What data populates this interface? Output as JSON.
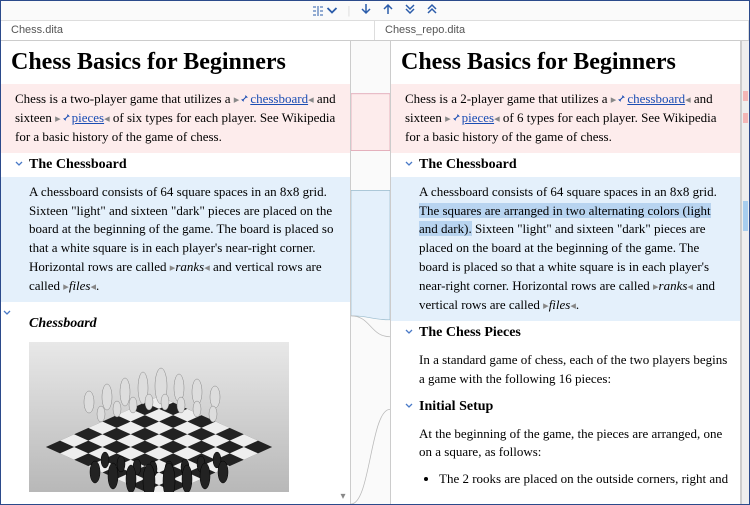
{
  "toolbar": {
    "algo_icon": "algorithm-icon",
    "dropdown_icon": "dropdown-icon",
    "next_diff_icon": "arrow-down-icon",
    "prev_diff_icon": "arrow-up-icon",
    "last_diff_icon": "double-arrow-down-icon",
    "first_diff_icon": "double-arrow-up-icon"
  },
  "tabs": {
    "left": "Chess.dita",
    "right": "Chess_repo.dita"
  },
  "left": {
    "title": "Chess Basics for Beginners",
    "intro_pre": "Chess is a ",
    "intro_two": "two-player",
    "intro_mid1": " game that utilizes a ",
    "link_board": "chessboard",
    "intro_mid2": " and sixteen ",
    "link_pieces": "pieces",
    "intro_mid3": " of ",
    "intro_six": "six",
    "intro_post": " types for each player. See Wikipedia for a basic history of the game of chess.",
    "sec1_title": "The Chessboard",
    "sec1_body": "A chessboard consists of 64 square spaces in an 8x8 grid. Sixteen \"light\" and sixteen \"dark\" pieces are placed on the board at the beginning of the game. The board is placed so that a white square is in each player's near-right corner. Horizontal rows are called ",
    "ranks": "ranks",
    "sec1_mid": " and vertical rows are called ",
    "files": "files",
    "period": ".",
    "fig_title": "Chessboard"
  },
  "right": {
    "title": "Chess Basics for Beginners",
    "intro_pre": "Chess is a ",
    "intro_two": "2-player",
    "intro_mid1": " game that utilizes a ",
    "link_board": "chessboard",
    "intro_mid2": " and sixteen ",
    "link_pieces": "pieces",
    "intro_mid3": " of ",
    "intro_six": "6",
    "intro_post": " types for each player. See Wikipedia for a basic history of the game of chess.",
    "sec1_title": "The Chessboard",
    "sec1_p1": "A chessboard consists of 64 square spaces in an 8x8 grid. ",
    "sec1_ins": "The squares are arranged in two alternating colors (light and dark).",
    "sec1_p2": " Sixteen \"light\" and sixteen \"dark\" pieces are placed on the board at the beginning of the game. The board is placed so that a white square is in each player's near-right corner. Horizontal rows are called ",
    "ranks": "ranks",
    "sec1_mid": " and vertical rows are called ",
    "files": "files",
    "period": ".",
    "sec2_title": "The Chess Pieces",
    "sec2_body": "In a standard game of chess, each of the two players begins a game with the following 16 pieces:",
    "sec3_title": "Initial Setup",
    "sec3_body": "At the beginning of the game, the pieces are arranged, one on a square, as follows:",
    "sec3_b1": "The 2 rooks are placed on the outside corners, right and"
  }
}
